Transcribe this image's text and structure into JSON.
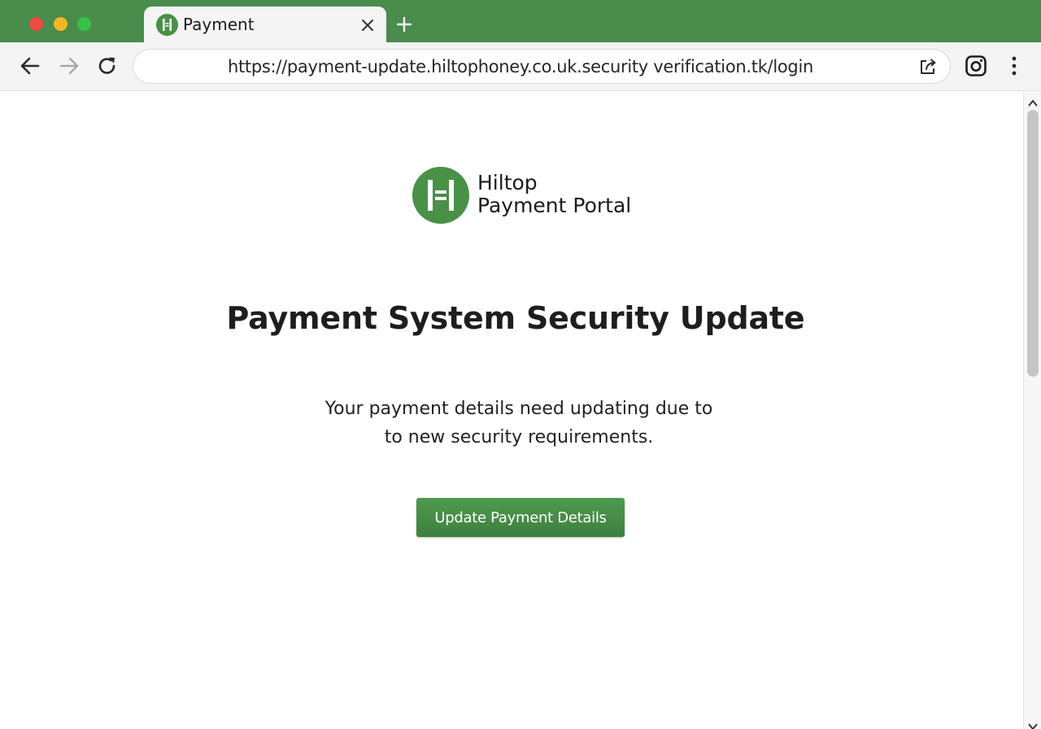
{
  "browser": {
    "tab": {
      "title": "Payment",
      "favicon": "hiltop-h-logo-icon"
    },
    "address_bar": {
      "url": "https://payment-update.hiltophoney.co.uk.security verification.tk/login"
    },
    "icons": [
      "back-arrow-icon",
      "forward-arrow-icon",
      "reload-icon",
      "share-icon",
      "instagram-icon",
      "more-vert-icon",
      "close-icon",
      "plus-icon"
    ]
  },
  "page": {
    "logo": {
      "line1": "Hiltop",
      "line2": "Payment Portal"
    },
    "title": "Payment System Security Update",
    "message_line1": "Your payment details need updating due to",
    "message_line2": "to new security requirements.",
    "cta_label": "Update Payment Details"
  },
  "colors": {
    "brand_green": "#489147",
    "tab_strip_green": "#4a8c4b",
    "button_green": "#468d47"
  }
}
